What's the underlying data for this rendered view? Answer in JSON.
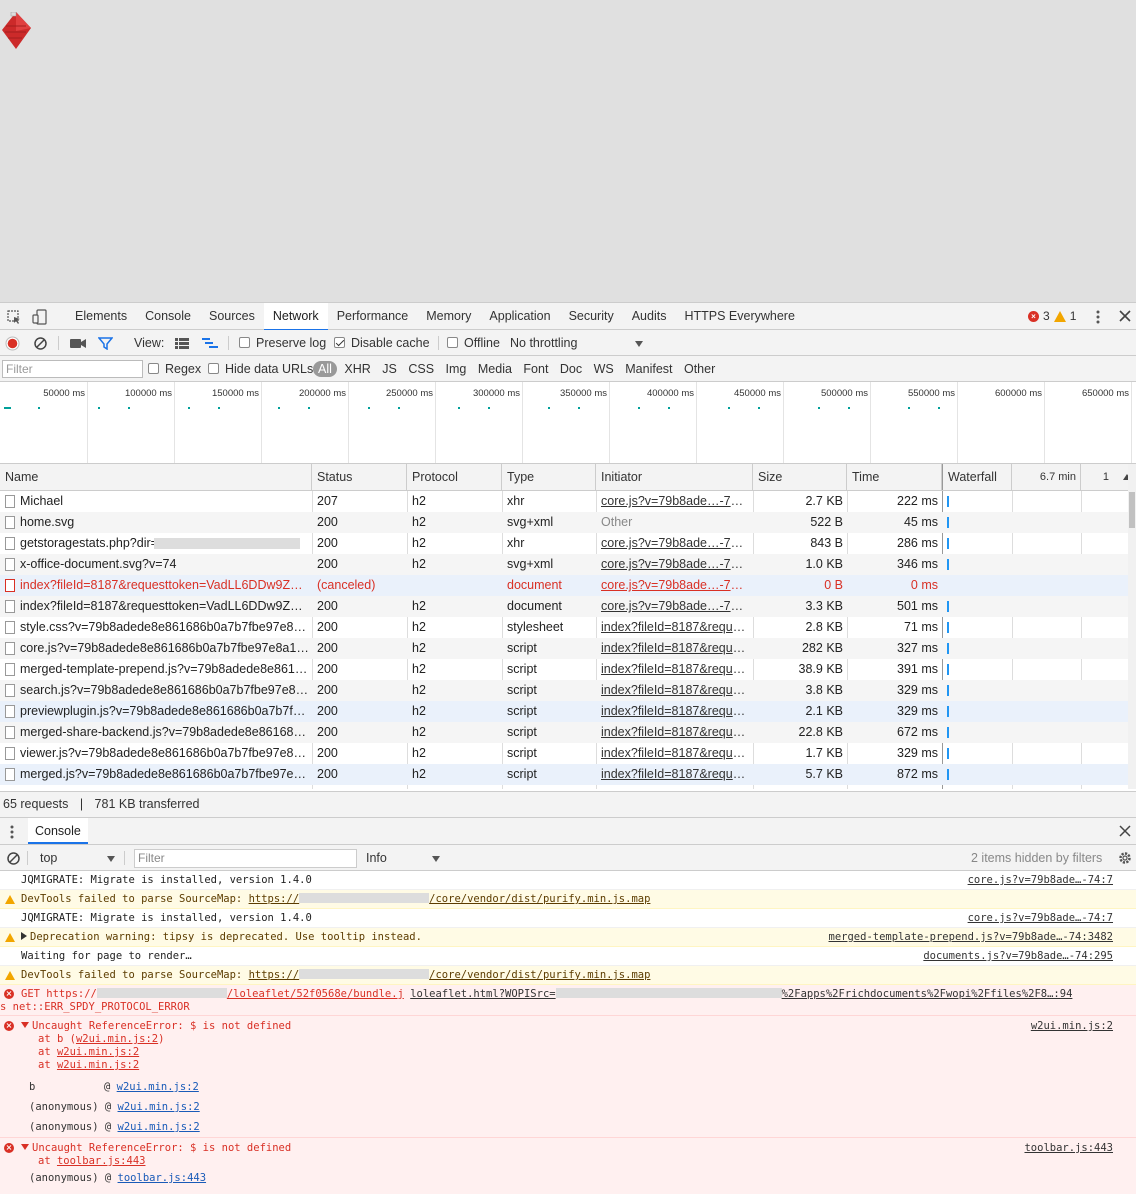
{
  "devtools": {
    "tabs": [
      "Elements",
      "Console",
      "Sources",
      "Network",
      "Performance",
      "Memory",
      "Application",
      "Security",
      "Audits",
      "HTTPS Everywhere"
    ],
    "active_tab": "Network",
    "error_count": "3",
    "warning_count": "1"
  },
  "network_toolbar": {
    "view_label": "View:",
    "preserve_log": "Preserve log",
    "disable_cache": "Disable cache",
    "offline": "Offline",
    "throttling": "No throttling",
    "filter_placeholder": "Filter",
    "regex": "Regex",
    "hide_data_urls": "Hide data URLs",
    "types": [
      "All",
      "XHR",
      "JS",
      "CSS",
      "Img",
      "Media",
      "Font",
      "Doc",
      "WS",
      "Manifest",
      "Other"
    ]
  },
  "overview": {
    "ticks": [
      "50000 ms",
      "100000 ms",
      "150000 ms",
      "200000 ms",
      "250000 ms",
      "300000 ms",
      "350000 ms",
      "400000 ms",
      "450000 ms",
      "500000 ms",
      "550000 ms",
      "600000 ms",
      "650000 ms"
    ]
  },
  "table": {
    "headers": {
      "name": "Name",
      "status": "Status",
      "protocol": "Protocol",
      "type": "Type",
      "initiator": "Initiator",
      "size": "Size",
      "time": "Time",
      "waterfall": "Waterfall",
      "wf_time": "6.7 min",
      "wf_col": "1"
    },
    "rows": [
      {
        "name": "Michael",
        "status": "207",
        "protocol": "h2",
        "type": "xhr",
        "initiator": "core.js?v=79b8ade…-74:5…",
        "size": "2.7 KB",
        "time": "222 ms"
      },
      {
        "name": "home.svg",
        "status": "200",
        "protocol": "h2",
        "type": "svg+xml",
        "initiator": "Other",
        "size": "522 B",
        "time": "45 ms"
      },
      {
        "name": "getstoragestats.php?dir=",
        "status": "200",
        "protocol": "h2",
        "type": "xhr",
        "initiator": "core.js?v=79b8ade…-74:4",
        "size": "843 B",
        "time": "286 ms"
      },
      {
        "name": "x-office-document.svg?v=74",
        "status": "200",
        "protocol": "h2",
        "type": "svg+xml",
        "initiator": "core.js?v=79b8ade…-74:4",
        "size": "1.0 KB",
        "time": "346 ms"
      },
      {
        "name": "index?fileId=8187&requesttoken=VadLL6DDw9ZW0…",
        "status": "(canceled)",
        "protocol": "",
        "type": "document",
        "initiator": "core.js?v=79b8ade…-74:3",
        "size": "0 B",
        "time": "0 ms"
      },
      {
        "name": "index?fileId=8187&requesttoken=VadLL6DDw9ZW0…",
        "status": "200",
        "protocol": "h2",
        "type": "document",
        "initiator": "core.js?v=79b8ade…-74:3",
        "size": "3.3 KB",
        "time": "501 ms"
      },
      {
        "name": "style.css?v=79b8adede8e861686b0a7b7fbe97e8a1-…",
        "status": "200",
        "protocol": "h2",
        "type": "stylesheet",
        "initiator": "index?fileId=8187&reques…",
        "size": "2.8 KB",
        "time": "71 ms"
      },
      {
        "name": "core.js?v=79b8adede8e861686b0a7b7fbe97e8a1-74",
        "status": "200",
        "protocol": "h2",
        "type": "script",
        "initiator": "index?fileId=8187&reques…",
        "size": "282 KB",
        "time": "327 ms"
      },
      {
        "name": "merged-template-prepend.js?v=79b8adede8e86168…",
        "status": "200",
        "protocol": "h2",
        "type": "script",
        "initiator": "index?fileId=8187&reques…",
        "size": "38.9 KB",
        "time": "391 ms"
      },
      {
        "name": "search.js?v=79b8adede8e861686b0a7b7fbe97e8a1…",
        "status": "200",
        "protocol": "h2",
        "type": "script",
        "initiator": "index?fileId=8187&reques…",
        "size": "3.8 KB",
        "time": "329 ms"
      },
      {
        "name": "previewplugin.js?v=79b8adede8e861686b0a7b7fbe…",
        "status": "200",
        "protocol": "h2",
        "type": "script",
        "initiator": "index?fileId=8187&reques…",
        "size": "2.1 KB",
        "time": "329 ms"
      },
      {
        "name": "merged-share-backend.js?v=79b8adede8e861686b0…",
        "status": "200",
        "protocol": "h2",
        "type": "script",
        "initiator": "index?fileId=8187&reques…",
        "size": "22.8 KB",
        "time": "672 ms"
      },
      {
        "name": "viewer.js?v=79b8adede8e861686b0a7b7fbe97e8a1-…",
        "status": "200",
        "protocol": "h2",
        "type": "script",
        "initiator": "index?fileId=8187&reques…",
        "size": "1.7 KB",
        "time": "329 ms"
      },
      {
        "name": "merged.js?v=79b8adede8e861686b0a7b7fbe97e8a…",
        "status": "200",
        "protocol": "h2",
        "type": "script",
        "initiator": "index?fileId=8187&reques…",
        "size": "5.7 KB",
        "time": "872 ms"
      }
    ]
  },
  "statusbar": {
    "requests": "65 requests",
    "sep": "|",
    "transferred": "781 KB transferred"
  },
  "console": {
    "tab_label": "Console",
    "context": "top",
    "filter_placeholder": "Filter",
    "level": "Info",
    "hidden_info": "2 items hidden by filters",
    "messages": [
      {
        "kind": "log",
        "text": "JQMIGRATE: Migrate is installed, version 1.4.0",
        "src": "core.js?v=79b8ade…-74:7"
      },
      {
        "kind": "warn",
        "pre": "DevTools failed to parse SourceMap: ",
        "link": "https://",
        "post": "/core/vendor/dist/purify.min.js.map",
        "src": ""
      },
      {
        "kind": "log",
        "text": "JQMIGRATE: Migrate is installed, version 1.4.0",
        "src": "core.js?v=79b8ade…-74:7"
      },
      {
        "kind": "warn",
        "text": "Deprecation warning: tipsy is deprecated. Use tooltip instead.",
        "src": "merged-template-prepend.js?v=79b8ade…-74:3482"
      },
      {
        "kind": "log",
        "text": "Waiting for page to render…",
        "src": "documents.js?v=79b8ade…-74:295"
      },
      {
        "kind": "warn",
        "pre": "DevTools failed to parse SourceMap: ",
        "link": "https://",
        "post": "/core/vendor/dist/purify.min.js.map",
        "src": ""
      },
      {
        "kind": "error",
        "text1": "GET https://",
        "text2": "/loleaflet/52f0568e/bundle.j",
        "text3": "loleaflet.html?WOPISrc=",
        "text4": "%2Fapps%2Frichdocuments%2Fwopi%2Ffiles%2F8…:94",
        "line2": "s net::ERR_SPDY_PROTOCOL_ERROR"
      },
      {
        "kind": "error",
        "text": "Uncaught ReferenceError: $ is not defined",
        "stack": [
          "at b (w2ui.min.js:2)",
          "at w2ui.min.js:2",
          "at w2ui.min.js:2"
        ],
        "frames": [
          {
            "fn": "b",
            "at": "@",
            "file": "w2ui.min.js:2"
          },
          {
            "fn": "(anonymous)",
            "at": "@",
            "file": "w2ui.min.js:2"
          },
          {
            "fn": "(anonymous)",
            "at": "@",
            "file": "w2ui.min.js:2"
          }
        ],
        "src": "w2ui.min.js:2"
      },
      {
        "kind": "error",
        "text": "Uncaught ReferenceError: $ is not defined",
        "stack": [
          "at toolbar.js:443"
        ],
        "frames": [
          {
            "fn": "(anonymous)",
            "at": "@",
            "file": "toolbar.js:443"
          }
        ],
        "src": "toolbar.js:443"
      }
    ]
  },
  "colors": {
    "accent": "#1a73e8",
    "error": "#d93025",
    "warning": "#f2a600",
    "record": "#d93025"
  }
}
